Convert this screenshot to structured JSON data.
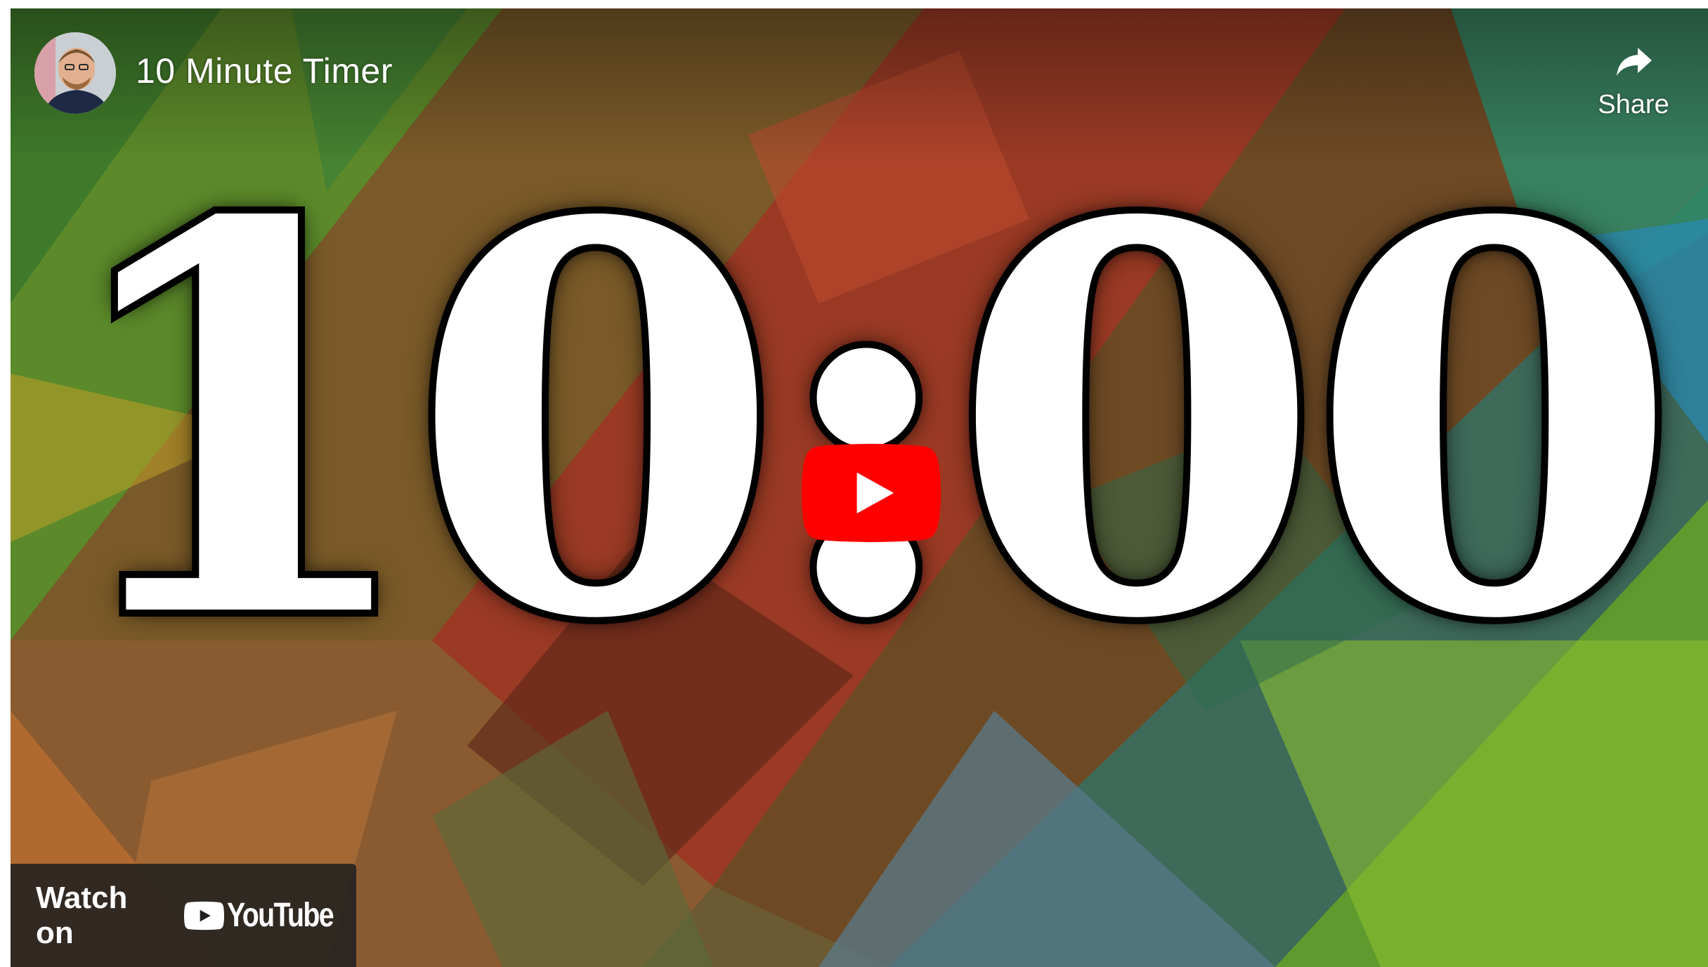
{
  "video": {
    "title": "10 Minute Timer",
    "timer_text": "10:00"
  },
  "share": {
    "label": "Share",
    "icon": "share-arrow-icon"
  },
  "watch_on": {
    "label": "Watch on",
    "brand": "YouTube",
    "icon": "youtube-logo-icon"
  },
  "play_button": {
    "icon": "play-icon",
    "color": "#ff0000"
  },
  "avatar": {
    "icon": "channel-avatar"
  }
}
